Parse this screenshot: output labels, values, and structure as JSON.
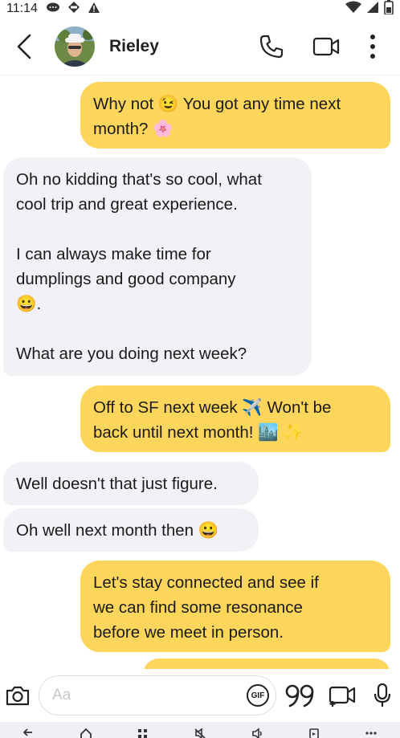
{
  "status_bar": {
    "time": "11:14",
    "icons": [
      "chat-bubble-icon",
      "vpn-icon",
      "alert-icon",
      "wifi-icon",
      "signal-icon",
      "battery-icon"
    ]
  },
  "header": {
    "back_icon": "chevron-left-icon",
    "contact_name": "Rieley",
    "actions": [
      "phone-icon",
      "video-camera-icon",
      "more-vertical-icon"
    ]
  },
  "messages": [
    {
      "direction": "outgoing",
      "text": "Why not 😉 You got any time next\nmonth? 🌸"
    },
    {
      "direction": "incoming",
      "text": "Oh no kidding that's so cool, what\ncool trip and great experience.\n\nI can always make time for\ndumplings and good company\n😀.\n\nWhat are you doing next week?"
    },
    {
      "direction": "outgoing",
      "text": "Off to SF next week ✈️ Won't be\nback until next month! 🏙️ ✨"
    },
    {
      "direction": "incoming",
      "text": "Well doesn't that just figure."
    },
    {
      "direction": "incoming",
      "text": "Oh well next month then 😀"
    },
    {
      "direction": "outgoing",
      "text": "Let's stay connected and see if\nwe can find some resonance\nbefore we meet in person."
    }
  ],
  "composer": {
    "placeholder": "Aa",
    "gif_label": "GIF",
    "icons": [
      "camera-icon",
      "gif-icon",
      "quote-icon",
      "video-note-icon",
      "microphone-icon"
    ]
  },
  "colors": {
    "outgoing_bubble": "#ffd65c",
    "incoming_bubble": "#f2f1f6"
  }
}
